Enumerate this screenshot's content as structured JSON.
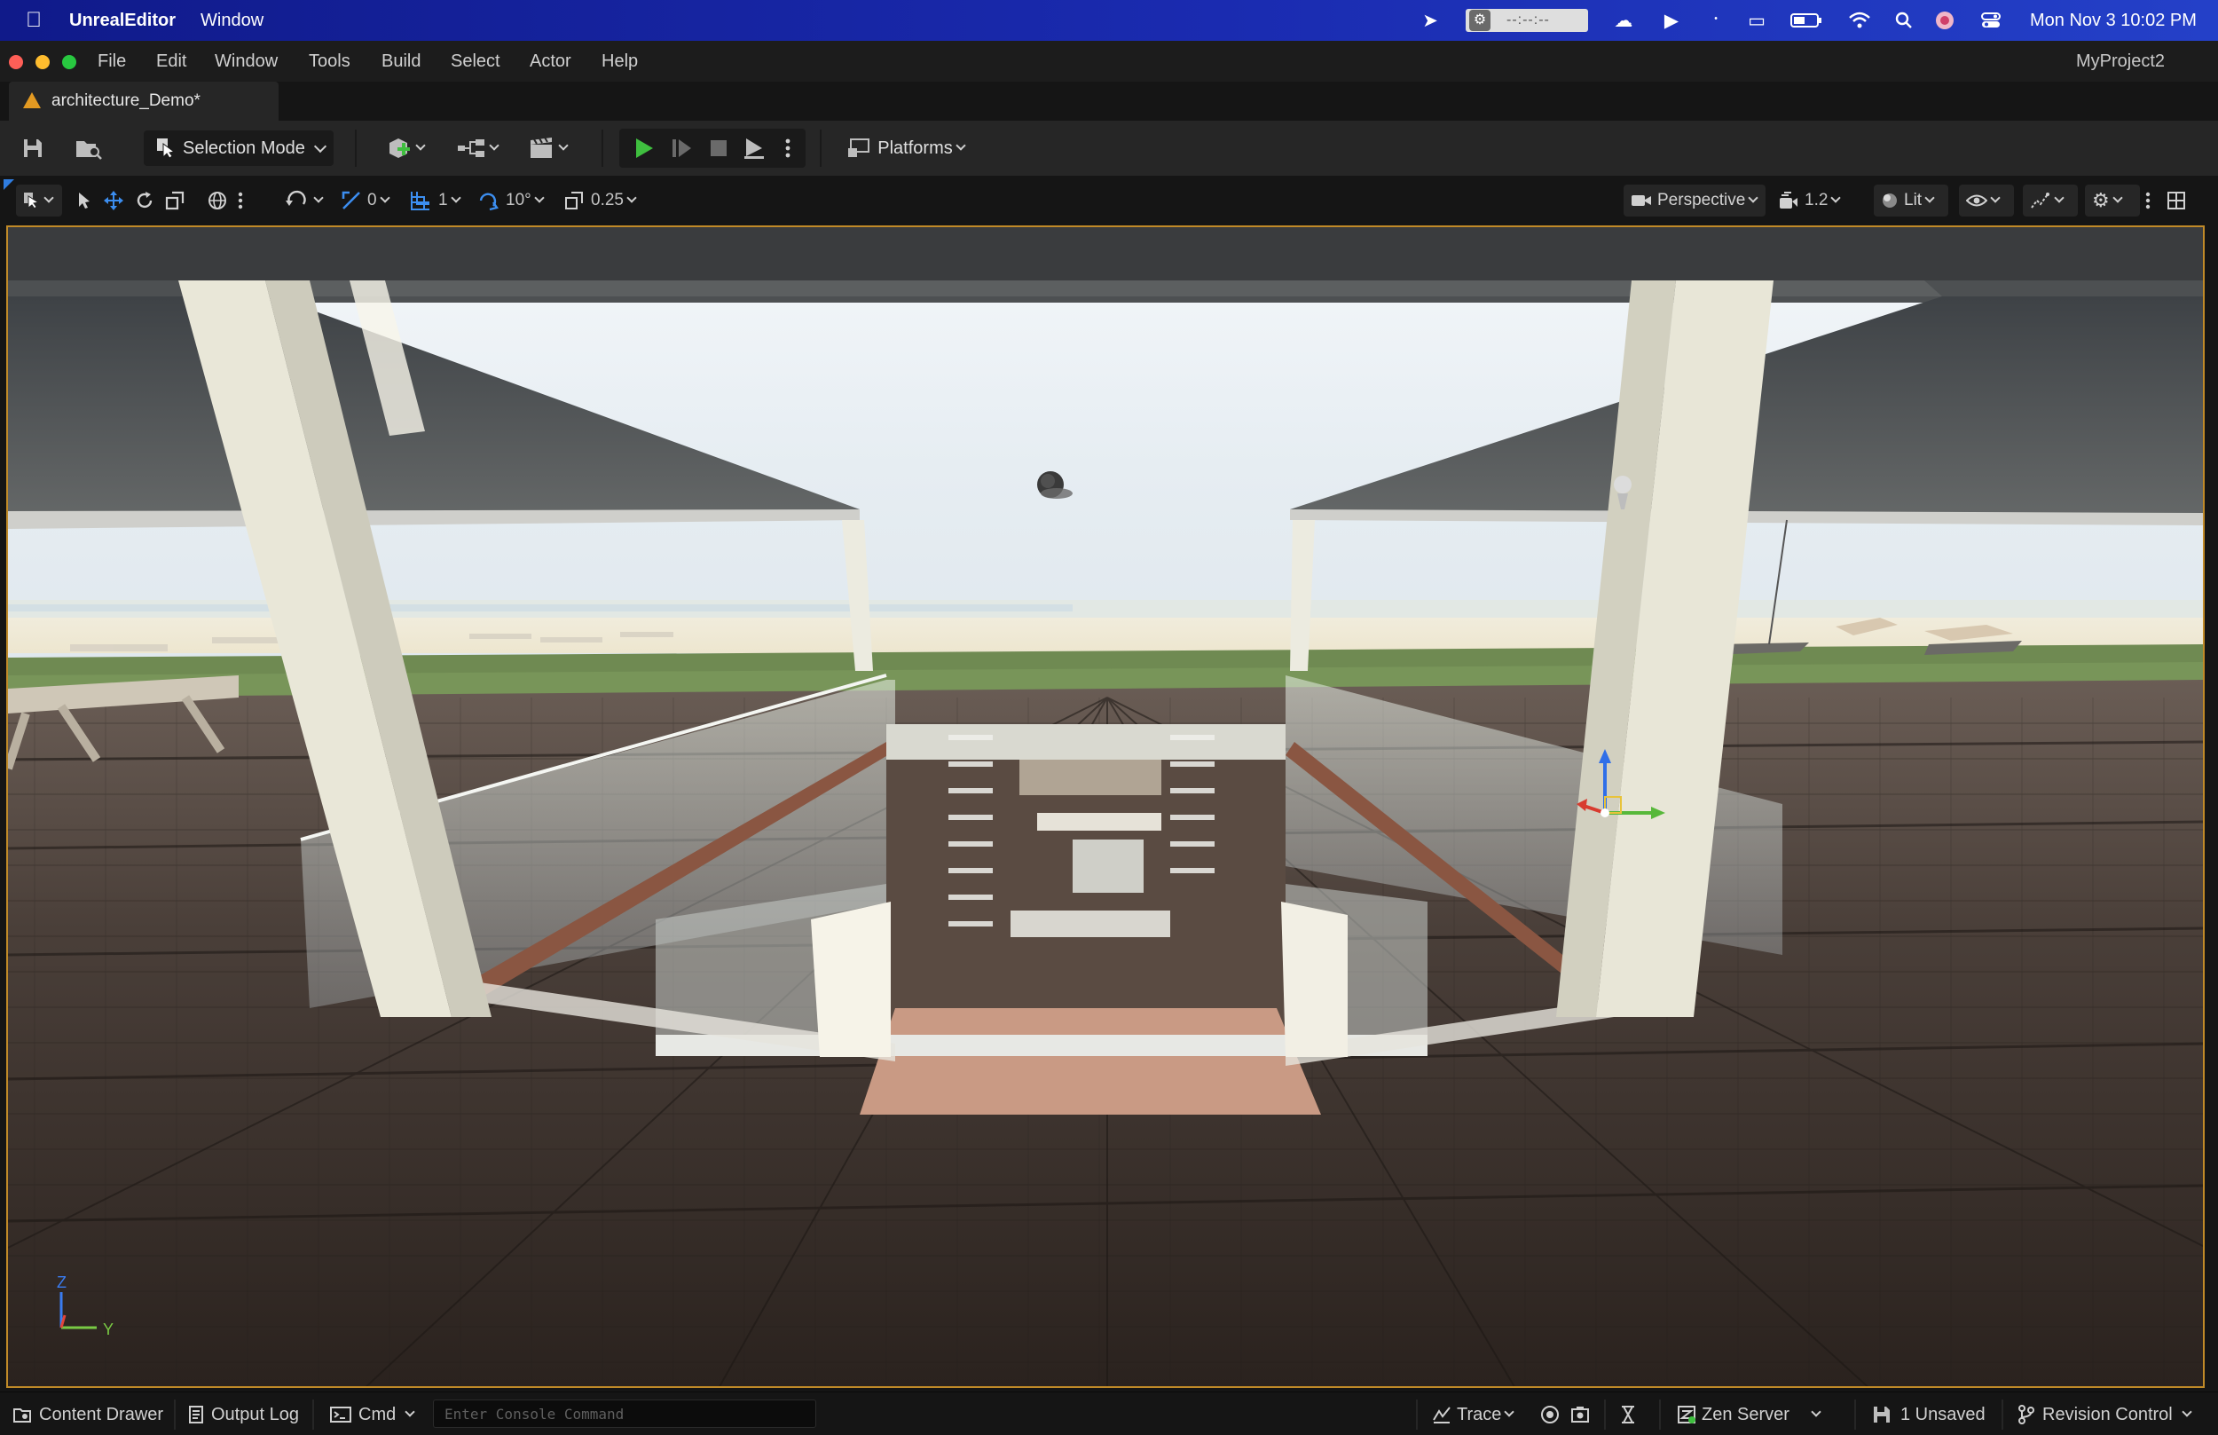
{
  "mac_menu": {
    "app_name": "UnrealEditor",
    "window_label": "Window",
    "clock_placeholder": "--:--:--",
    "date_time": "Mon Nov 3  10:02 PM"
  },
  "app_menu": {
    "items": [
      "File",
      "Edit",
      "Window",
      "Tools",
      "Build",
      "Select",
      "Actor",
      "Help"
    ],
    "project_name": "MyProject2"
  },
  "tabs": {
    "document": "architecture_Demo*"
  },
  "toolbar": {
    "selection_mode": "Selection Mode",
    "platforms": "Platforms"
  },
  "viewport_toolbar": {
    "rotation_snap": "0",
    "grid_snap": "1",
    "angle_snap": "10°",
    "scale_snap": "0.25",
    "view_mode": "Perspective",
    "camera_speed": "1.2",
    "lighting_mode": "Lit"
  },
  "viewport": {
    "axis_z": "Z",
    "axis_y": "Y"
  },
  "status_bar": {
    "content_drawer": "Content Drawer",
    "output_log": "Output Log",
    "cmd": "Cmd",
    "console_placeholder": "Enter Console Command",
    "trace": "Trace",
    "zen_server": "Zen Server",
    "unsaved": "1 Unsaved",
    "revision_control": "Revision Control"
  },
  "colors": {
    "accent_play": "#3fbf3f",
    "ue_tab_icon": "#e39a22",
    "viewport_border": "#c08a28"
  }
}
